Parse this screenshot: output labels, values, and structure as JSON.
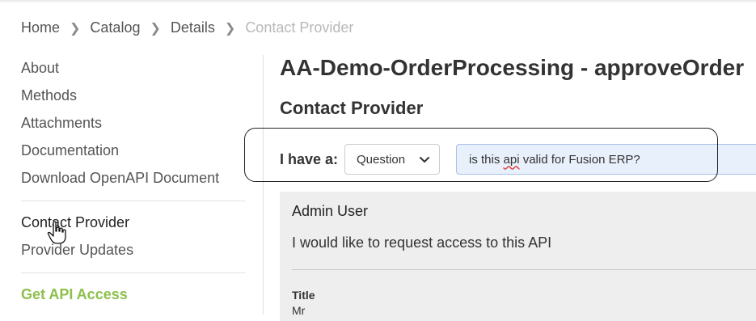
{
  "breadcrumb": {
    "items": [
      "Home",
      "Catalog",
      "Details",
      "Contact Provider"
    ]
  },
  "sidebar": {
    "items": [
      {
        "label": "About"
      },
      {
        "label": "Methods"
      },
      {
        "label": "Attachments"
      },
      {
        "label": "Documentation"
      },
      {
        "label": "Download OpenAPI Document"
      }
    ],
    "contact_items": [
      {
        "label": "Contact Provider"
      },
      {
        "label": "Provider Updates"
      }
    ],
    "get_access_label": "Get API Access"
  },
  "main": {
    "title": "AA-Demo-OrderProcessing - approveOrder",
    "section_title": "Contact Provider",
    "form": {
      "ihave_label": "I have a:",
      "type_selected": "Question",
      "subject_prefix": "is this ",
      "subject_misspelled": "api",
      "subject_suffix": " valid for Fusion ERP?"
    },
    "message": {
      "author": "Admin User",
      "body": "I would like to request access to this API",
      "title_label": "Title",
      "title_value": "Mr"
    }
  },
  "colors": {
    "accent_green": "#8dc04c",
    "input_bg": "#e8f0fb",
    "card_bg": "#eeeeee"
  }
}
